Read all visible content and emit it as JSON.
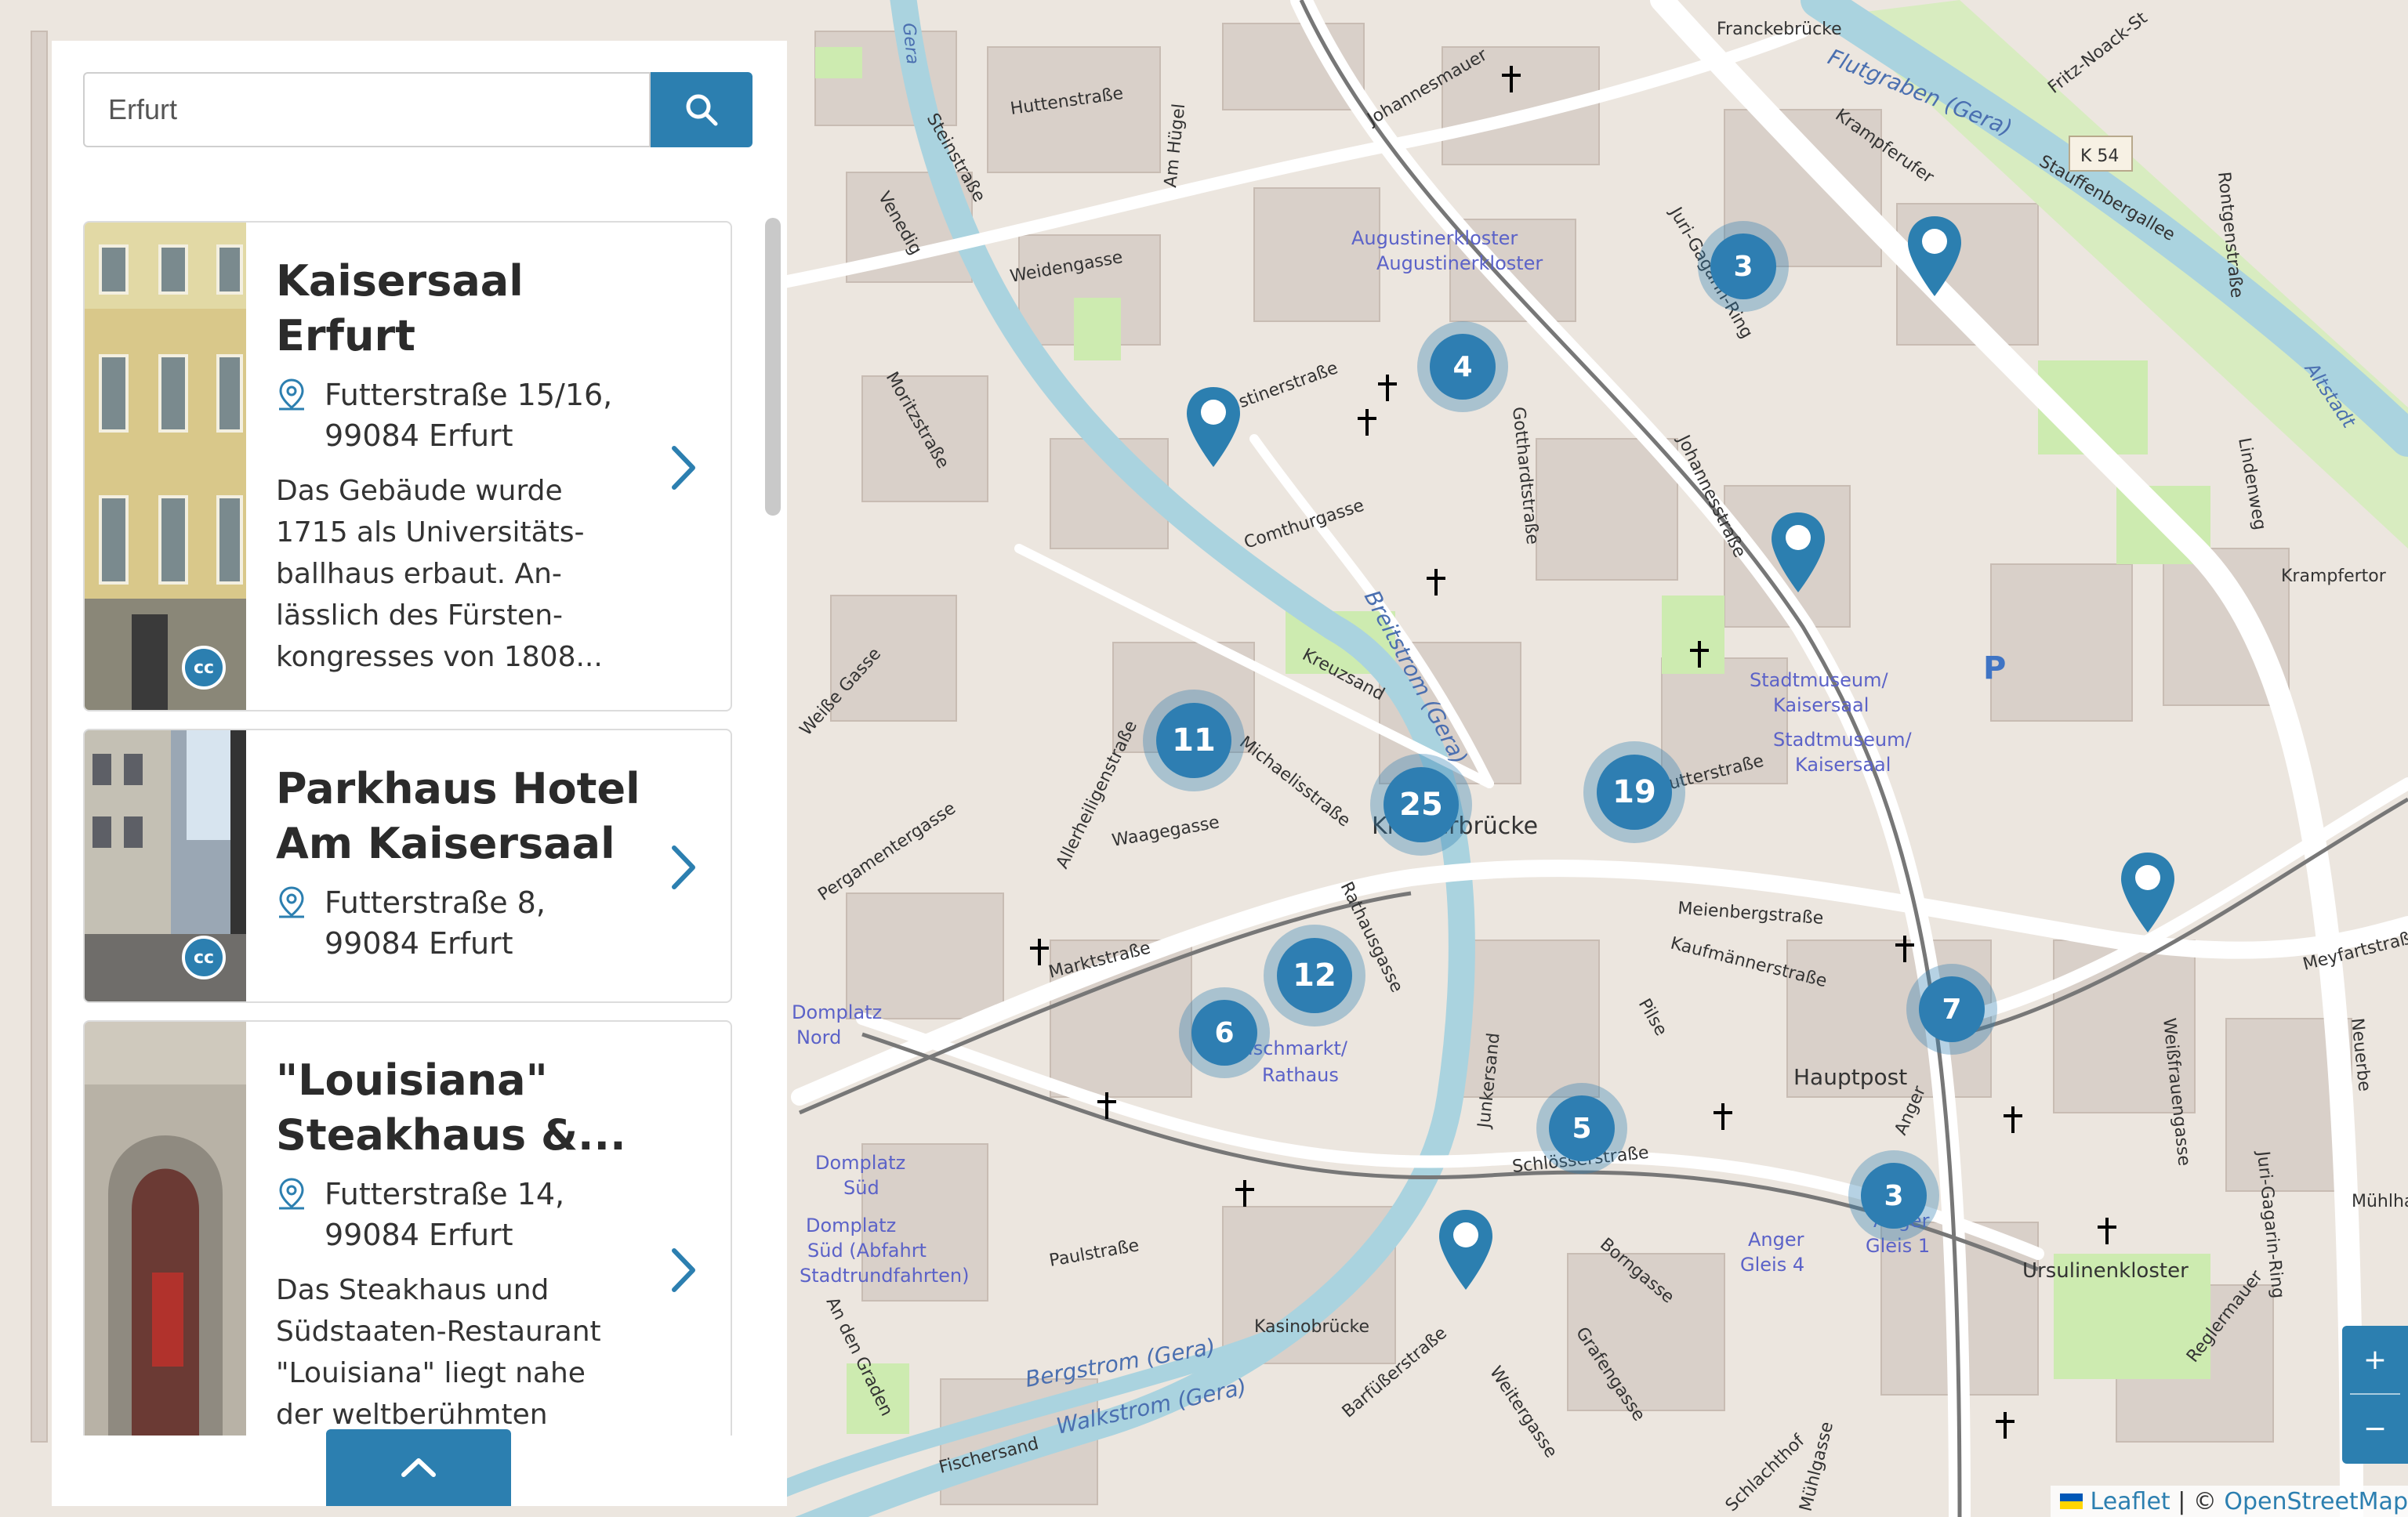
{
  "search": {
    "value": "Erfurt",
    "icon": "search-icon"
  },
  "results": [
    {
      "title": "Kaisersaal Erfurt",
      "title_lines": [
        "Kaisersaal",
        "Erfurt"
      ],
      "address_lines": [
        "Futterstraße 15/16,",
        "99084 Erfurt"
      ],
      "description_lines": [
        "Das Gebäude wurde",
        "1715 als Universitäts-",
        "ballhaus erbaut. An-",
        "lässlich des Fürsten-",
        "kongresses von 1808..."
      ],
      "license": "cc"
    },
    {
      "title": "Parkhaus Hotel Am Kaisersaal",
      "title_lines": [
        "Parkhaus Hotel",
        "Am Kaisersaal"
      ],
      "address_lines": [
        "Futterstraße 8,",
        "99084 Erfurt"
      ],
      "description_lines": [],
      "license": "cc"
    },
    {
      "title": "\"Louisiana\" Steakhaus &...",
      "title_lines": [
        "\"Louisiana\"",
        "Steakhaus &..."
      ],
      "address_lines": [
        "Futterstraße 14,",
        "99084 Erfurt"
      ],
      "description_lines": [
        "Das Steakhaus und",
        "Südstaaten-Restaurant",
        "\"Louisiana\" liegt nahe",
        "der weltberühmten"
      ],
      "license": ""
    }
  ],
  "map": {
    "clusters": [
      {
        "count": "3"
      },
      {
        "count": "4"
      },
      {
        "count": "11"
      },
      {
        "count": "25"
      },
      {
        "count": "19"
      },
      {
        "count": "12"
      },
      {
        "count": "6"
      },
      {
        "count": "5"
      },
      {
        "count": "7"
      },
      {
        "count": "3"
      }
    ],
    "street_labels": [
      "Franckebrücke",
      "Huttenstraße",
      "Johannesmauer",
      "Weidengasse",
      "Am Hügel",
      "Augustinerkloster",
      "Augustinerkloster",
      "Juri-Gagarin-Ring",
      "Krampferufer",
      "Stauffenbergallee",
      "K 54",
      "Rontgenstraße",
      "Fritz-Noack-St",
      "Steinstraße",
      "Venedig",
      "Moritzstraße",
      "Augustinerstraße",
      "Comthurgasse",
      "Gotthardtstraße",
      "Johannesstraße",
      "Lindenweg",
      "Krampfertor",
      "Kreuzsand",
      "Stadtmuseum/",
      "Kaisersaal",
      "Stadtmuseum/",
      "Kaisersaal",
      "Michaelisstraße",
      "Futterstraße",
      "Krämerbrücke",
      "Waagegasse",
      "Allerheiligenstraße",
      "Pergamentergasse",
      "Weiße Gasse",
      "Meienbergstraße",
      "Kaufmännerstraße",
      "Meyfartstraße",
      "Marktstraße",
      "Rathausgasse",
      "Fischmarkt/",
      "Rathaus",
      "Domplatz",
      "Nord",
      "Hauptpost",
      "Junkersand",
      "Pilse",
      "Schlösserstraße",
      "Anger",
      "Domplatz",
      "Süd",
      "Domplatz",
      "Süd (Abfahrt",
      "Stadtrundfahrten)",
      "Paulstraße",
      "Borngasse",
      "Anger",
      "Gleis 4",
      "Anger",
      "Gleis 1",
      "Ursulinenkloster",
      "Weißfrauengasse",
      "Kasinobrücke",
      "Barfüßerstraße",
      "Weitergasse",
      "Grafengasse",
      "Reglermauer",
      "Fischersand",
      "Schlachthof",
      "Mühlgasse",
      "An den Graden",
      "Mühlhausen",
      "Neuerbe"
    ],
    "water_labels": [
      "Flutgraben (Gera)",
      "Breitstrom (Gera)",
      "Bergstrom (Gera)",
      "Walkstrom (Gera)",
      "Gera",
      "Altstadt"
    ]
  },
  "zoom": {
    "in": "+",
    "out": "−"
  },
  "attribution": {
    "leaflet": "Leaflet",
    "separator": " | © ",
    "osm": "OpenStreetMap"
  },
  "colors": {
    "accent": "#2c7fb0",
    "cluster": "#2e7eb2",
    "map_bg": "#f2efe9",
    "water": "#aad3df",
    "park": "#cdebb0"
  }
}
